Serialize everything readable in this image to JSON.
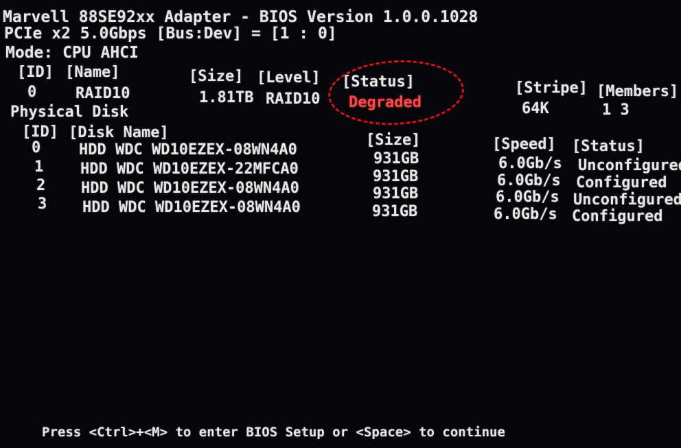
{
  "header": {
    "line1": "Marvell 88SE92xx Adapter - BIOS Version 1.0.0.1028",
    "line2": "PCIe x2 5.0Gbps [Bus:Dev] = [1 : 0]",
    "mode": "Mode: CPU AHCI"
  },
  "virtual_disk": {
    "columns": {
      "id": "[ID]",
      "name": "[Name]",
      "size": "[Size]",
      "level": "[Level]",
      "status": "[Status]",
      "stripe": "[Stripe]",
      "members": "[Members]"
    },
    "row": {
      "id": "0",
      "name": "RAID10",
      "size": "1.81TB",
      "level": "RAID10",
      "status": "Degraded",
      "stripe": "64K",
      "members": "1 3"
    },
    "status_color": "#ff4a4a",
    "annotation_color": "#d61414"
  },
  "physical_disk": {
    "section_title": "Physical Disk",
    "columns": {
      "id": "[ID]",
      "disk_name": "[Disk Name]",
      "size": "[Size]",
      "speed": "[Speed]",
      "status": "[Status]"
    },
    "rows": [
      {
        "id": "0",
        "disk_name": "HDD WDC WD10EZEX-08WN4A0",
        "size": "931GB",
        "speed": "6.0Gb/s",
        "status": "Unconfigured"
      },
      {
        "id": "1",
        "disk_name": "HDD WDC WD10EZEX-22MFCA0",
        "size": "931GB",
        "speed": "6.0Gb/s",
        "status": "Configured"
      },
      {
        "id": "2",
        "disk_name": "HDD WDC WD10EZEX-08WN4A0",
        "size": "931GB",
        "speed": "6.0Gb/s",
        "status": "Unconfigured"
      },
      {
        "id": "3",
        "disk_name": "HDD WDC WD10EZEX-08WN4A0",
        "size": "931GB",
        "speed": "6.0Gb/s",
        "status": "Configured"
      }
    ]
  },
  "footer": {
    "prompt": "Press <Ctrl>+<M> to enter BIOS Setup or <Space> to continue"
  }
}
